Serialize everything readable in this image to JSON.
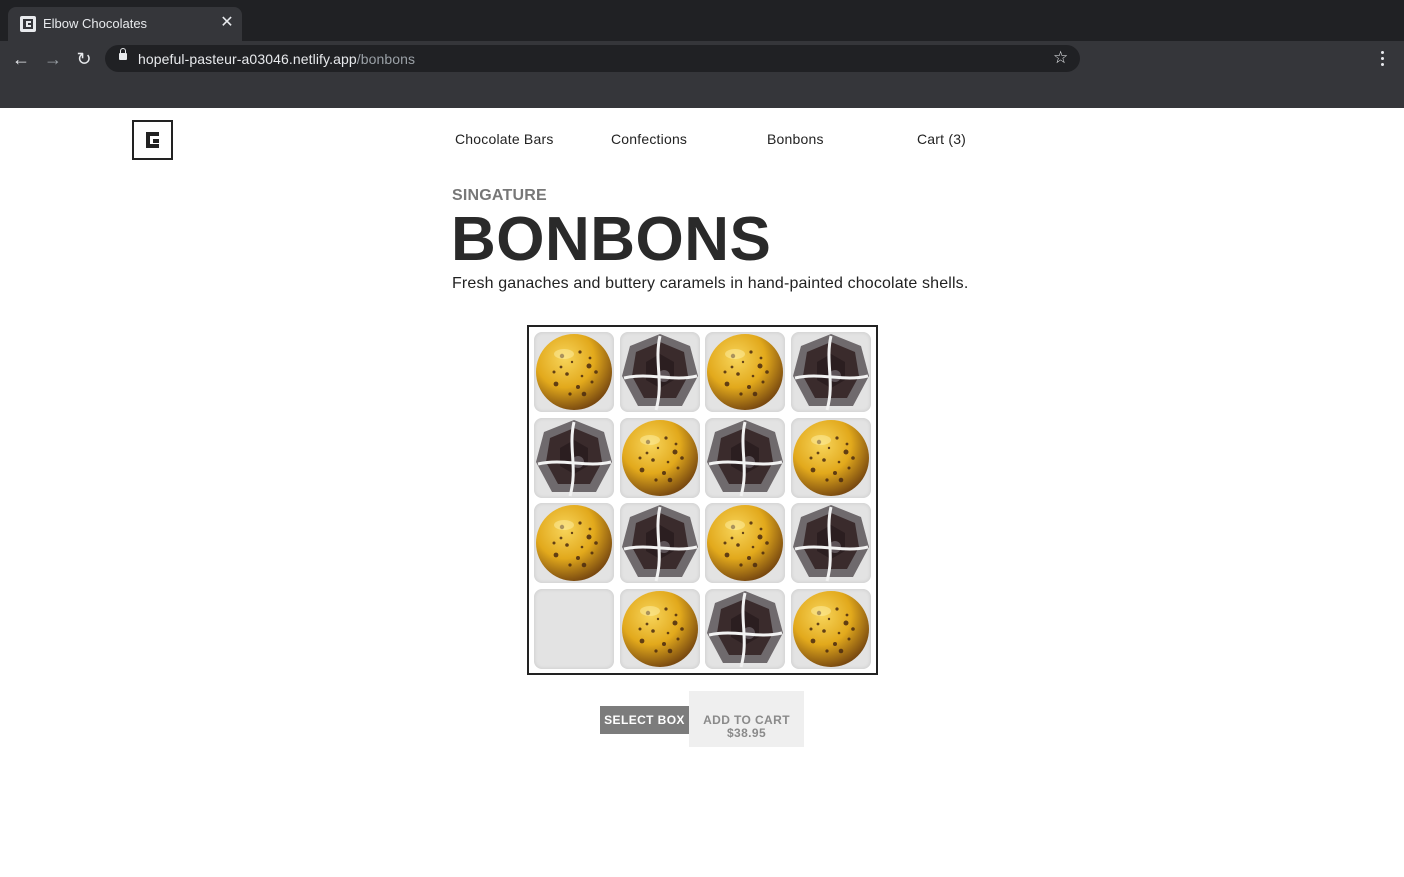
{
  "browser": {
    "tab_title": "Elbow Chocolates",
    "tab_close": "✕",
    "url_host": "hopeful-pasteur-a03046.netlify.app",
    "url_path": "/bonbons",
    "back_icon": "←",
    "forward_icon": "→",
    "reload_icon": "↻",
    "star_icon": "☆"
  },
  "nav": {
    "items": [
      "Chocolate Bars",
      "Confections",
      "Bonbons",
      "Cart (3)"
    ]
  },
  "hero": {
    "eyebrow": "SINGATURE",
    "title": "BONBONS",
    "subtitle": "Fresh ganaches and buttery caramels in hand-painted chocolate shells."
  },
  "box": {
    "grid": [
      [
        "gold",
        "dark",
        "gold",
        "dark"
      ],
      [
        "dark",
        "gold",
        "dark",
        "gold"
      ],
      [
        "gold",
        "dark",
        "gold",
        "dark"
      ],
      [
        "empty",
        "gold",
        "dark",
        "gold"
      ]
    ]
  },
  "actions": {
    "select_box": "SELECT BOX",
    "add_to_cart": "ADD TO CART",
    "price": "$38.95"
  },
  "colors": {
    "chrome_dark": "#202124",
    "chrome": "#35363a",
    "gold": "#e2a91c",
    "dark_chocolate": "#3a2b2c",
    "select_button": "#7c7c7c"
  }
}
